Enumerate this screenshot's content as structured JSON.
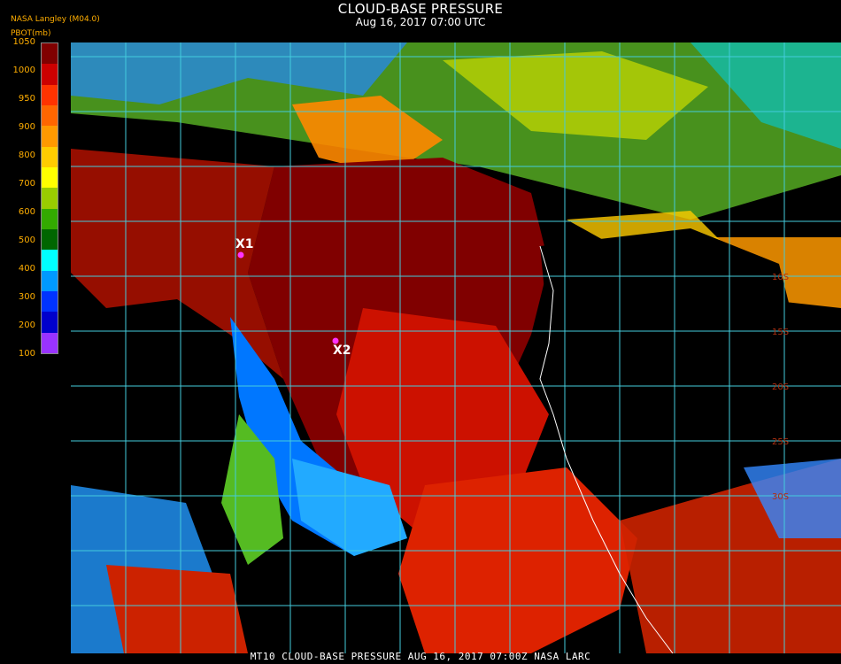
{
  "header": {
    "title": "CLOUD-BASE PRESSURE",
    "subtitle": "Aug 16, 2017 07:00 UTC",
    "source": "NASA Langley (M04.0)",
    "units": "PBOT(mb)"
  },
  "colorbar": {
    "ticks": [
      "1050",
      "1000",
      "950",
      "900",
      "800",
      "700",
      "600",
      "500",
      "400",
      "300",
      "200",
      "100"
    ],
    "colors": [
      "#800000",
      "#cc0000",
      "#ff3300",
      "#ff6600",
      "#ff9900",
      "#ffcc00",
      "#ffff00",
      "#99cc00",
      "#33aa00",
      "#006600",
      "#00ffff",
      "#0099ff",
      "#0033ff",
      "#0000cc",
      "#9933ff"
    ]
  },
  "map": {
    "markers": [
      {
        "label": "X1",
        "name": "marker-x1"
      },
      {
        "label": "X2",
        "name": "marker-x2"
      }
    ],
    "lat_labels": [
      "10S",
      "15S",
      "20S",
      "25S",
      "30S"
    ]
  },
  "footer": {
    "text": "MT10  CLOUD-BASE PRESSURE   AUG 16, 2017 07:00Z   NASA LARC"
  }
}
